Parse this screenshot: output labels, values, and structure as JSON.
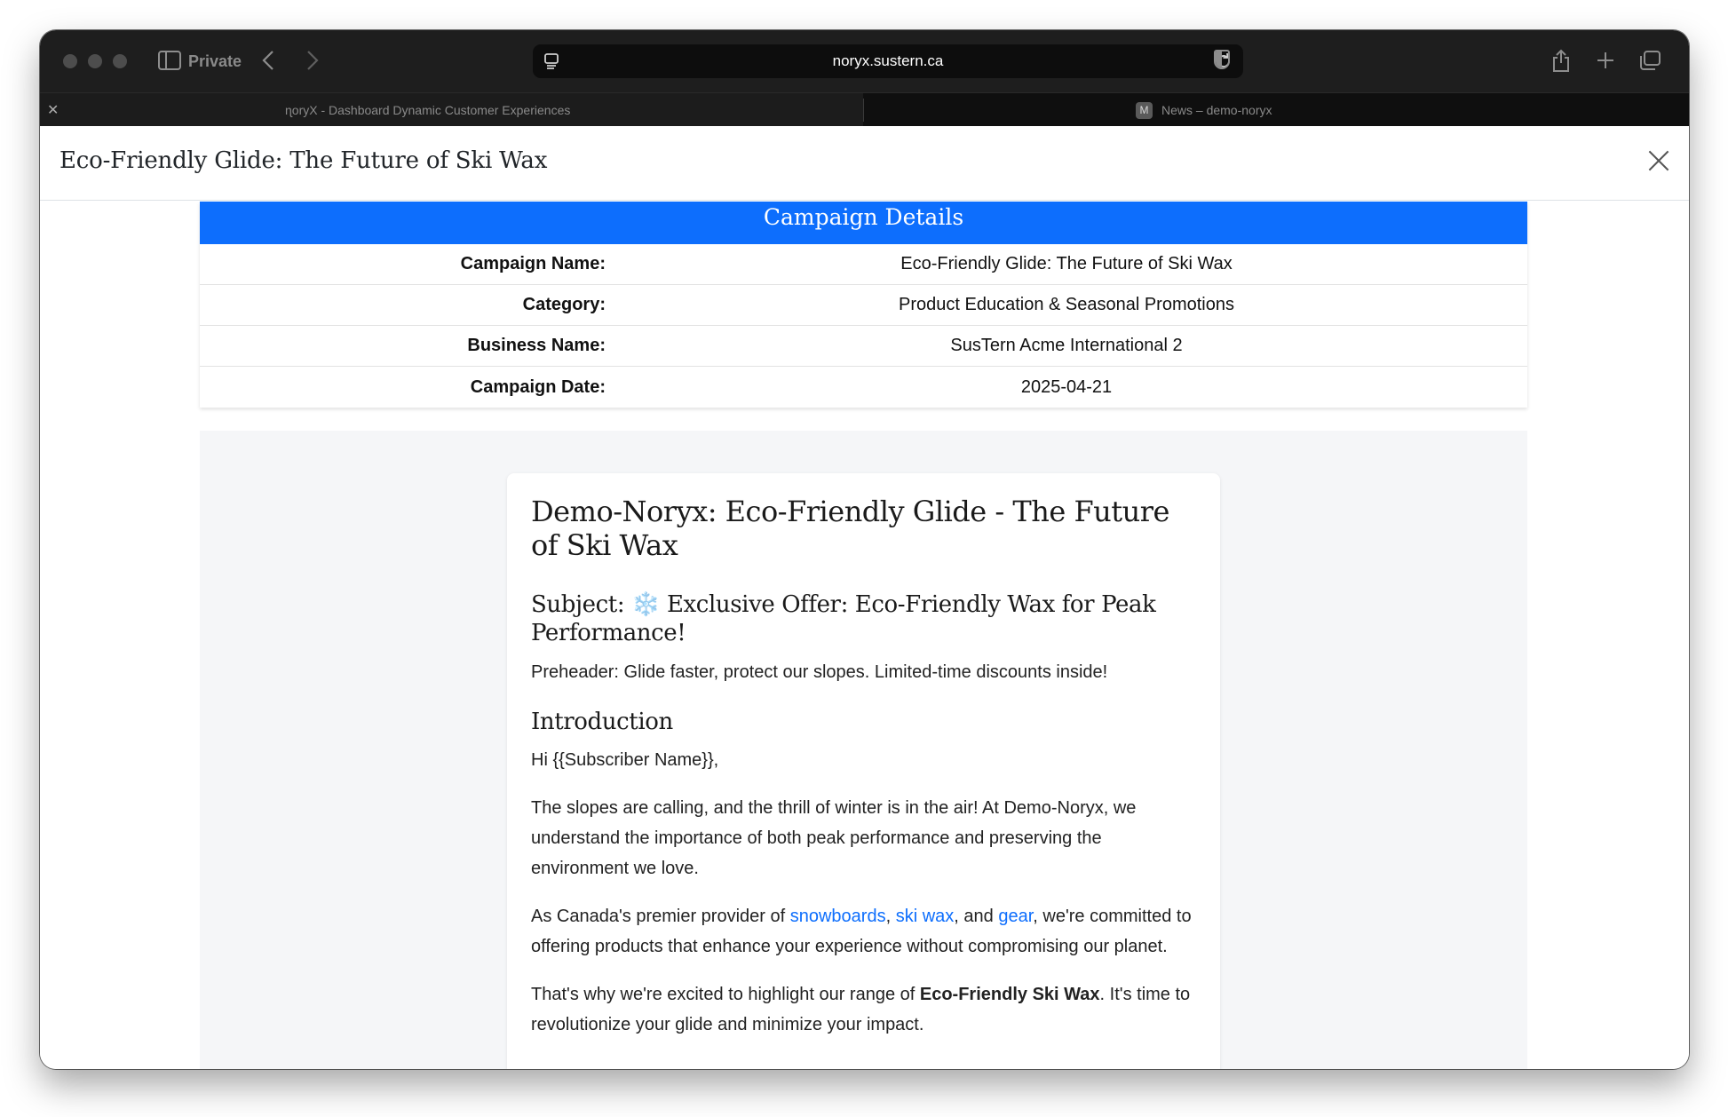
{
  "browser": {
    "private_label": "Private",
    "url": "noryx.sustern.ca",
    "tabs": [
      {
        "title": "ɳoryX - Dashboard Dynamic Customer Experiences",
        "active": true
      },
      {
        "title": "News – demo-noryx",
        "favicon_letter": "M",
        "active": false
      }
    ]
  },
  "modal": {
    "title": "Eco-Friendly Glide: The Future of Ski Wax"
  },
  "campaign_details": {
    "header": "Campaign Details",
    "rows": [
      {
        "label": "Campaign Name:",
        "value": "Eco-Friendly Glide: The Future of Ski Wax"
      },
      {
        "label": "Category:",
        "value": "Product Education & Seasonal Promotions"
      },
      {
        "label": "Business Name:",
        "value": "SusTern Acme International 2"
      },
      {
        "label": "Campaign Date:",
        "value": "2025-04-21"
      }
    ]
  },
  "email": {
    "title": "Demo-Noryx: Eco-Friendly Glide - The Future of Ski Wax",
    "subject_prefix": "Subject: ",
    "subject_emoji": "❄️",
    "subject_text": " Exclusive Offer: Eco-Friendly Wax for Peak Performance!",
    "preheader": "Preheader: Glide faster, protect our slopes. Limited-time discounts inside!",
    "intro_heading": "Introduction",
    "greeting": "Hi {{Subscriber Name}},",
    "para1": "The slopes are calling, and the thrill of winter is in the air! At Demo-Noryx, we understand the importance of both peak performance and preserving the environment we love.",
    "para2_start": "As Canada's premier provider of ",
    "link_snowboards": "snowboards",
    "sep1": ", ",
    "link_ski_wax": "ski wax",
    "sep2": ", and ",
    "link_gear": "gear",
    "para2_end": ", we're committed to offering products that enhance your experience without compromising our planet.",
    "para3_start": "That's why we're excited to highlight our range of ",
    "para3_bold": "Eco-Friendly Ski Wax",
    "para3_end": ". It's time to revolutionize your glide and minimize your impact."
  }
}
